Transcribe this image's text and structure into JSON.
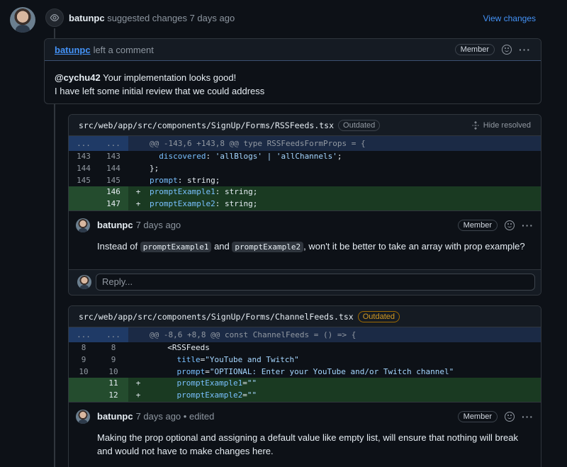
{
  "review": {
    "author": "batunpc",
    "action": "suggested changes",
    "time": "7 days ago",
    "view_changes": "View changes"
  },
  "main_comment": {
    "author": "batunpc",
    "action": "left a comment",
    "badge": "Member",
    "mention": "@cychu42",
    "line1": "Your implementation looks good!",
    "line2": "I have left some initial review that we could address"
  },
  "file1": {
    "path": "src/web/app/src/components/SignUp/Forms/RSSFeeds.tsx",
    "status": "Outdated",
    "hide_resolved": "Hide resolved",
    "hunk_dots": "...",
    "hunk": "@@ -143,6 +143,8 @@ type RSSFeedsFormProps = {",
    "lines": [
      {
        "old": "143",
        "new": "143",
        "sign": "",
        "prop": "discovered",
        "rest": ": ",
        "str": "'allBlogs' | 'allChannels'",
        "tail": ";",
        "indent": "  "
      },
      {
        "old": "144",
        "new": "144",
        "sign": "",
        "prop": "",
        "rest": "};",
        "str": "",
        "tail": "",
        "indent": ""
      },
      {
        "old": "145",
        "new": "145",
        "sign": "",
        "prop": "prompt",
        "rest": ": string;",
        "str": "",
        "tail": "",
        "indent": ""
      },
      {
        "old": "",
        "new": "146",
        "sign": "+",
        "prop": "promptExample1",
        "rest": ": string;",
        "str": "",
        "tail": "",
        "indent": ""
      },
      {
        "old": "",
        "new": "147",
        "sign": "+",
        "prop": "promptExample2",
        "rest": ": string;",
        "str": "",
        "tail": "",
        "indent": ""
      }
    ],
    "comment": {
      "author": "batunpc",
      "time": "7 days ago",
      "badge": "Member",
      "text_before": "Instead of",
      "chip1": "promptExample1",
      "text_mid": "and",
      "chip2": "promptExample2",
      "text_after": ", won't it be better to take an array with prop example?"
    },
    "reply_placeholder": "Reply..."
  },
  "file2": {
    "path": "src/web/app/src/components/SignUp/Forms/ChannelFeeds.tsx",
    "status": "Outdated",
    "hunk_dots": "...",
    "hunk": "@@ -8,6 +8,8 @@ const ChannelFeeds = () => {",
    "lines": [
      {
        "old": "8",
        "new": "8",
        "sign": "",
        "prop": "",
        "rest": "<RSSFeeds",
        "str": "",
        "indent": "  "
      },
      {
        "old": "9",
        "new": "9",
        "sign": "",
        "prop": "title",
        "rest": "=",
        "str": "\"YouTube and Twitch\"",
        "indent": "    "
      },
      {
        "old": "10",
        "new": "10",
        "sign": "",
        "prop": "prompt",
        "rest": "=",
        "str": "\"OPTIONAL: Enter your YouTube and/or Twitch channel\"",
        "indent": "    "
      },
      {
        "old": "",
        "new": "11",
        "sign": "+",
        "prop": "promptExample1",
        "rest": "=",
        "str": "\"\"",
        "indent": "    "
      },
      {
        "old": "",
        "new": "12",
        "sign": "+",
        "prop": "promptExample2",
        "rest": "=",
        "str": "\"\"",
        "indent": "    "
      }
    ],
    "comment": {
      "author": "batunpc",
      "time": "7 days ago",
      "edited": "• edited",
      "badge": "Member",
      "text": "Making the prop optional and assigning a default value like empty list, will ensure that nothing will break and would not have to make changes here."
    }
  }
}
